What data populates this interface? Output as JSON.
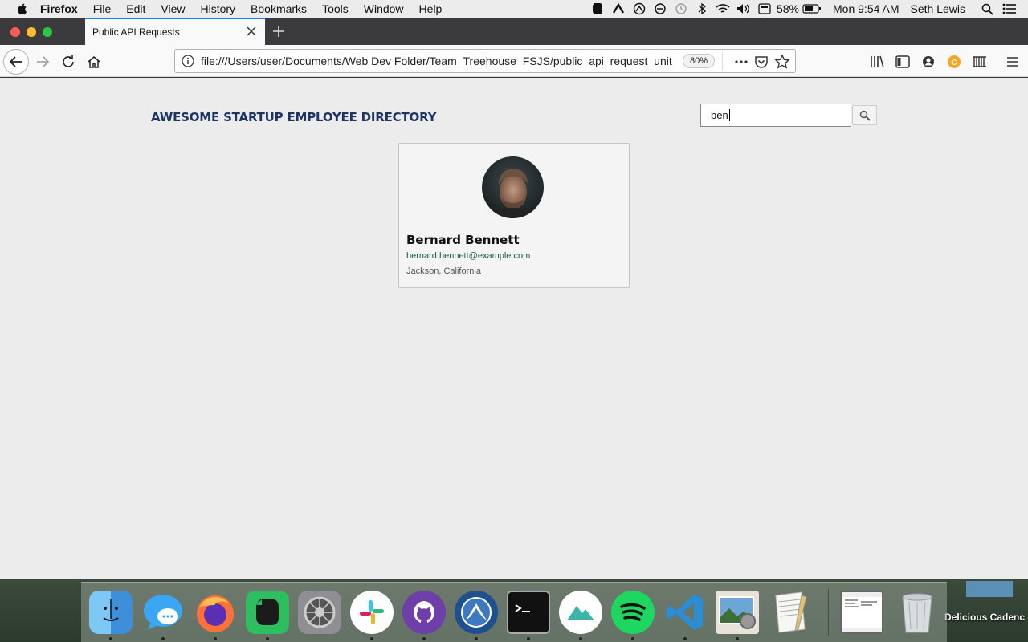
{
  "menubar": {
    "items": [
      "Firefox",
      "File",
      "Edit",
      "View",
      "History",
      "Bookmarks",
      "Tools",
      "Window",
      "Help"
    ],
    "battery": "58%",
    "clock": "Mon 9:54 AM",
    "user": "Seth Lewis"
  },
  "browser": {
    "tab_title": "Public API Requests",
    "url": "file:///Users/user/Documents/Web Dev Folder/Team_Treehouse_FSJS/public_api_request_unit",
    "zoom": "80%"
  },
  "page": {
    "title": "AWESOME STARTUP EMPLOYEE DIRECTORY",
    "search_value": "ben"
  },
  "card": {
    "name": "Bernard Bennett",
    "email": "bernard.bennett@example.com",
    "location": "Jackson, California"
  },
  "desktop": {
    "label": "Delicious Cadenc"
  },
  "colors": {
    "title": "#1d3566",
    "email": "#1c5b48",
    "tab_accent": "#0a84ff"
  }
}
